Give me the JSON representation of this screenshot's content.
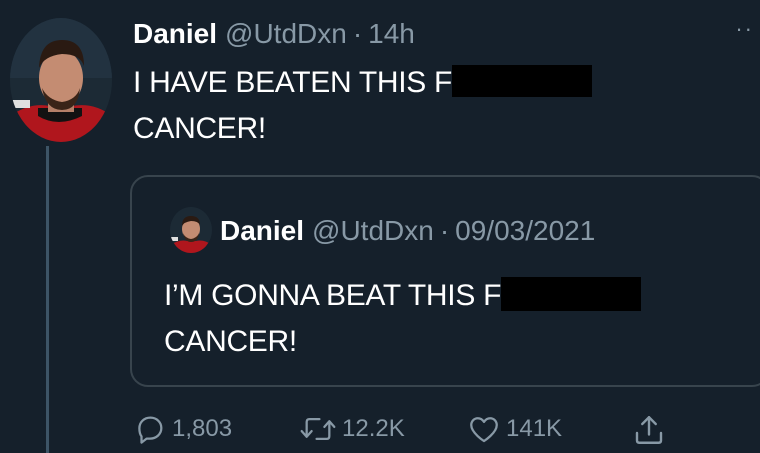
{
  "tweet": {
    "display_name": "Daniel",
    "handle": "@UtdDxn",
    "separator": "·",
    "time": "14h",
    "more": "··",
    "text_line1": "I HAVE BEATEN THIS F",
    "text_line2": "CANCER!"
  },
  "quoted": {
    "display_name": "Daniel",
    "handle": "@UtdDxn",
    "separator": "·",
    "date": "09/03/2021",
    "text_line1": "I’M GONNA BEAT THIS F",
    "text_line2": "CANCER!"
  },
  "actions": {
    "replies": "1,803",
    "retweets": "12.2K",
    "likes": "141K"
  },
  "icons": {
    "reply": "reply-icon",
    "retweet": "retweet-icon",
    "like": "heart-icon",
    "share": "share-icon",
    "more": "more-icon"
  },
  "colors": {
    "background": "#15202b",
    "secondary_text": "#8899a6",
    "border": "#38444d",
    "redaction": "#000000"
  }
}
